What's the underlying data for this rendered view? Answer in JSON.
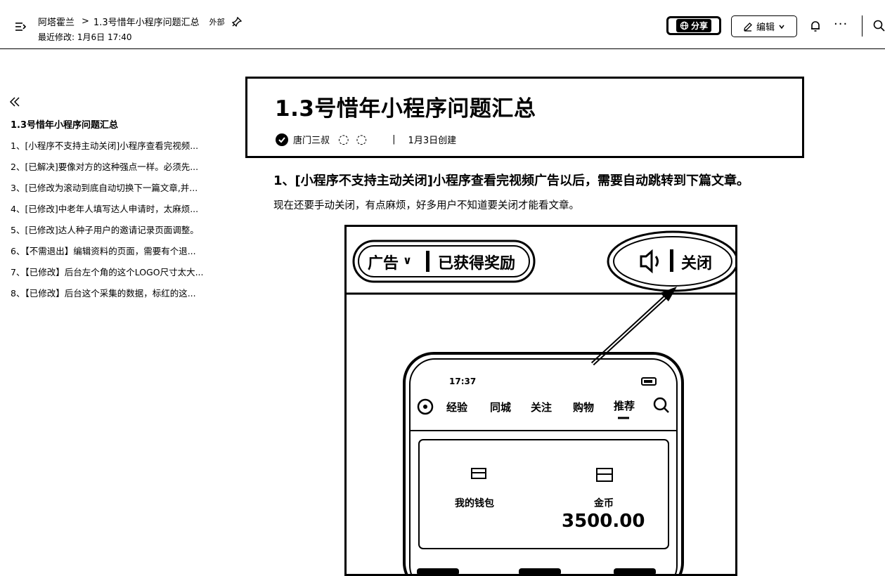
{
  "header": {
    "workspace": "阿塔霍兰",
    "crumb_sep": ">",
    "doc_name": "1.3号惜年小程序问题汇总",
    "external_tag": "外部",
    "last_modified": "最近修改: 1月6日 17:40",
    "share_label": "分享",
    "edit_label": "编辑",
    "more_label": "···"
  },
  "outline": {
    "title": "1.3号惜年小程序问题汇总",
    "items": [
      "1、[小程序不支持主动关闭]小程序查看完视频...",
      "2、[已解决]要像对方的这种强点一样。必须先...",
      "3、[已修改为滚动到底自动切换下一篇文章,并...",
      "4、[已修改]中老年人填写达人申请时，太麻烦...",
      "5、[已修改]达人种子用户的邀请记录页面调整。",
      "6、【不需退出】编辑资料的页面，需要有个退...",
      "7、【已修改】后台左个角的这个LOGO尺寸太大...",
      "8、【已修改】后台这个采集的数据，标红的这..."
    ]
  },
  "doc": {
    "title": "1.3号惜年小程序问题汇总",
    "author": "唐门三叔",
    "created": "1月3日创建",
    "section_heading": "1、[小程序不支持主动关闭]小程序查看完视频广告以后，需要自动跳转到下篇文章。",
    "section_text": "现在还要手动关闭，有点麻烦，好多用户不知道要关闭才能看文章。"
  },
  "image": {
    "ad_label": "广告",
    "reward_label": "已获得奖励",
    "close_label": "关闭",
    "phone_time": "17:37",
    "phone_tabs": [
      "经验",
      "同城",
      "关注",
      "购物",
      "推荐"
    ],
    "card_left_label": "我的钱包",
    "card_right_label": "金币",
    "card_amount": "3500.00"
  }
}
